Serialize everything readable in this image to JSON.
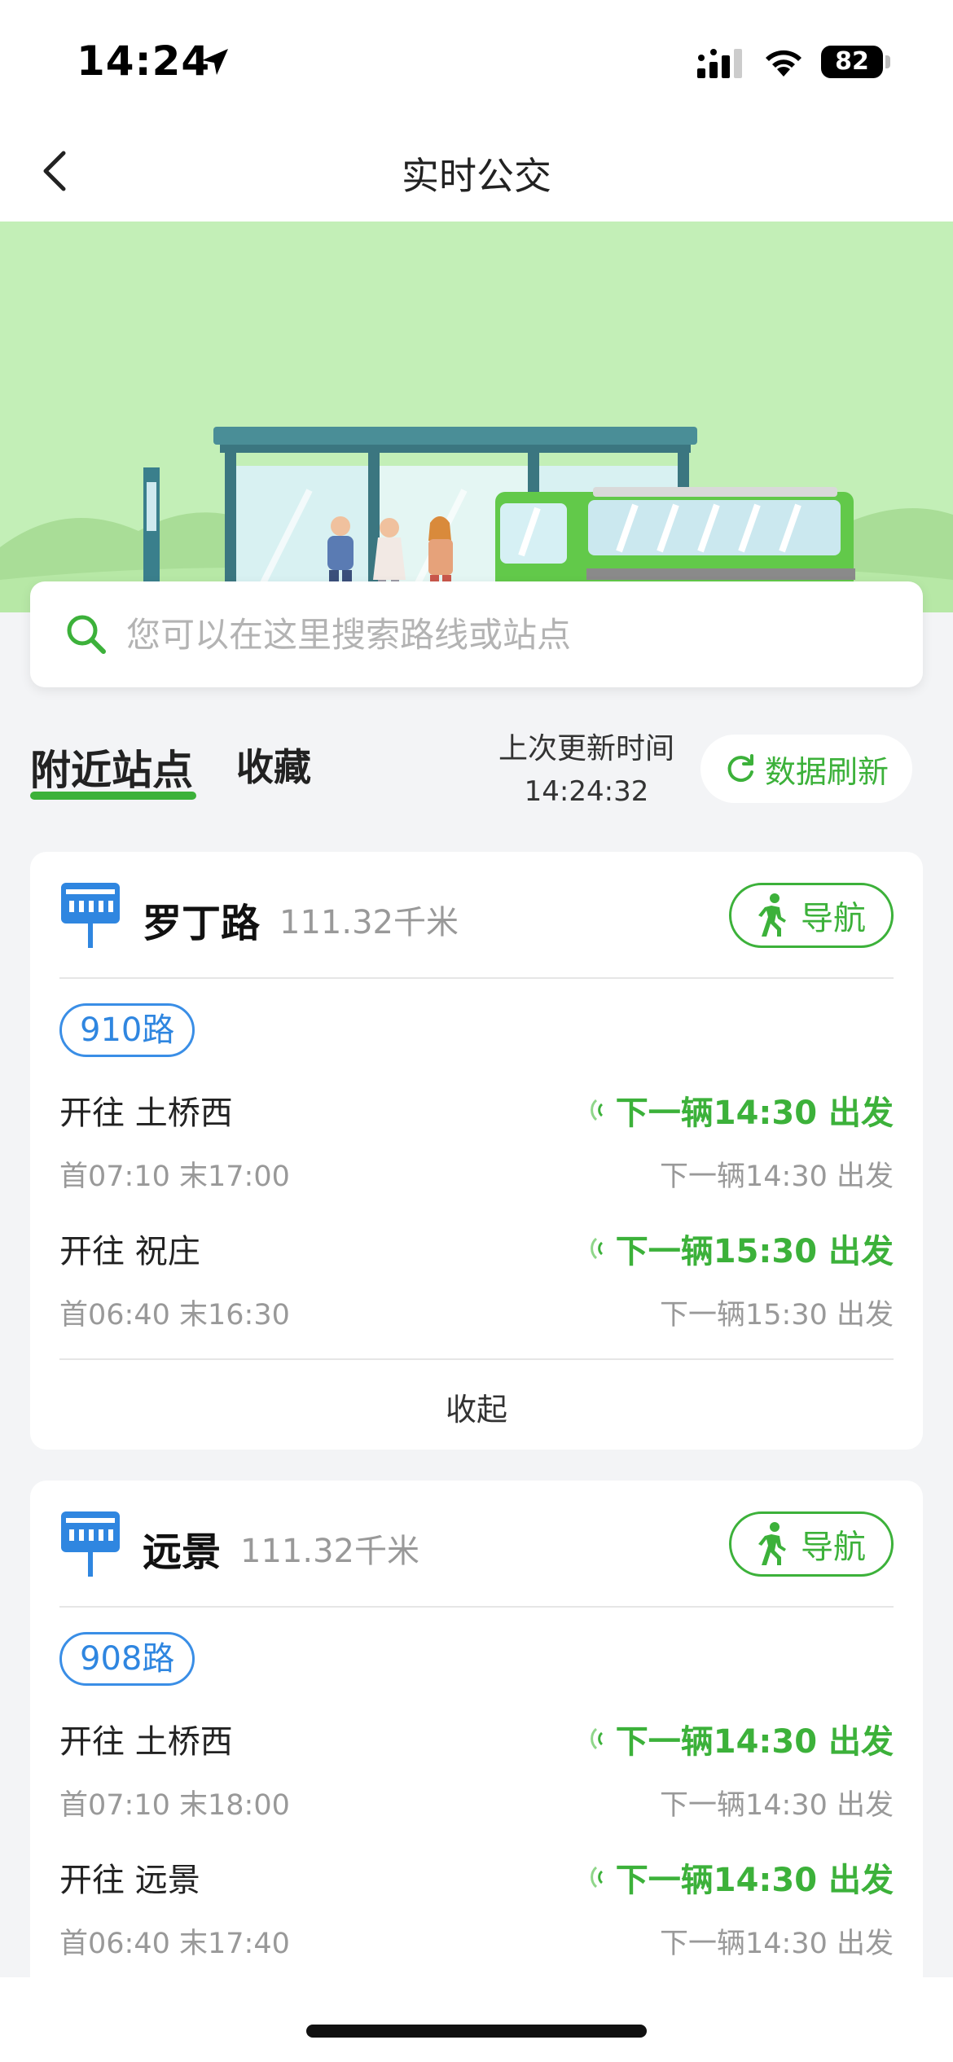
{
  "status_bar": {
    "time": "14:24",
    "battery": "82"
  },
  "nav": {
    "title": "实时公交"
  },
  "search": {
    "placeholder": "您可以在这里搜索路线或站点"
  },
  "tabs": {
    "nearby": "附近站点",
    "favorites": "收藏",
    "active": "nearby"
  },
  "update": {
    "label": "上次更新时间",
    "time": "14:24:32",
    "refresh_label": "数据刷新"
  },
  "stations": [
    {
      "name": "罗丁路",
      "distance": "111.32千米",
      "nav_label": "导航",
      "route": "910路",
      "directions": [
        {
          "label": "开往 土桥西",
          "next_bus": "下一辆14:30 出发",
          "hours": "首07:10 末17:00",
          "next_bus_secondary": "下一辆14:30 出发"
        },
        {
          "label": "开往 祝庄",
          "next_bus": "下一辆15:30 出发",
          "hours": "首06:40 末16:30",
          "next_bus_secondary": "下一辆15:30 出发"
        }
      ],
      "collapse_label": "收起"
    },
    {
      "name": "远景",
      "distance": "111.32千米",
      "nav_label": "导航",
      "route": "908路",
      "directions": [
        {
          "label": "开往 土桥西",
          "next_bus": "下一辆14:30 出发",
          "hours": "首07:10 末18:00",
          "next_bus_secondary": "下一辆14:30 出发"
        },
        {
          "label": "开往 远景",
          "next_bus": "下一辆14:30 出发",
          "hours": "首06:40 末17:40",
          "next_bus_secondary": "下一辆14:30 出发"
        }
      ]
    }
  ],
  "colors": {
    "accent_green": "#3cb13a",
    "route_blue": "#2f86e0",
    "banner_bg": "#c3efb7"
  },
  "icons": [
    "location-arrow-icon",
    "cellular-signal-icon",
    "wifi-icon",
    "battery-icon",
    "back-chevron-icon",
    "search-icon",
    "refresh-icon",
    "bus-stop-icon",
    "walking-person-icon",
    "realtime-signal-icon"
  ]
}
